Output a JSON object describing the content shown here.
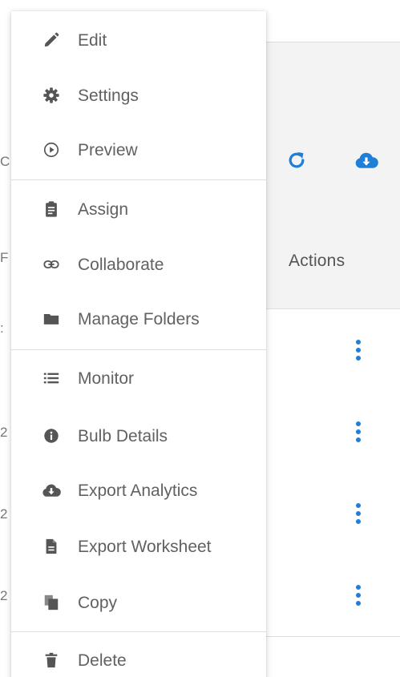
{
  "table": {
    "actions_header": "Actions",
    "header_icons": [
      "refresh-icon",
      "cloud-download-icon"
    ],
    "row_count": 4,
    "left_fragments": [
      "C",
      "F",
      ":",
      "2",
      "2",
      "2",
      "2"
    ]
  },
  "menu": {
    "items": [
      {
        "label": "Edit",
        "icon": "pencil-icon"
      },
      {
        "label": "Settings",
        "icon": "gear-icon"
      },
      {
        "label": "Preview",
        "icon": "play-circle-icon"
      },
      {
        "label": "Assign",
        "icon": "clipboard-icon"
      },
      {
        "label": "Collaborate",
        "icon": "link-icon"
      },
      {
        "label": "Manage Folders",
        "icon": "folder-icon"
      },
      {
        "label": "Monitor",
        "icon": "list-icon"
      },
      {
        "label": "Bulb Details",
        "icon": "info-icon"
      },
      {
        "label": "Export Analytics",
        "icon": "cloud-download-icon"
      },
      {
        "label": "Export Worksheet",
        "icon": "file-icon"
      },
      {
        "label": "Copy",
        "icon": "copy-icon"
      },
      {
        "label": "Delete",
        "icon": "trash-icon"
      }
    ]
  },
  "colors": {
    "accent_blue": "#1e7fd8",
    "menu_text": "#616161",
    "menu_icon": "#555555",
    "header_bg": "#f3f3f3"
  }
}
